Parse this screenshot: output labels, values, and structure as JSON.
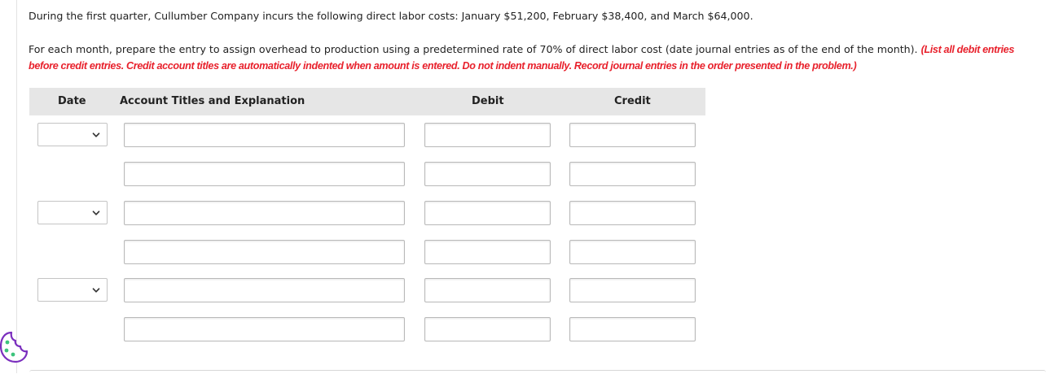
{
  "problem": {
    "intro": "During the first quarter, Cullumber Company incurs the following direct labor costs: January $51,200, February $38,400, and March $64,000.",
    "instruction": "For each month, prepare the entry to assign overhead to production using a predetermined rate of 70% of direct labor cost (date journal entries as of the end of the month).",
    "note": "(List all debit entries before credit entries. Credit account titles are automatically indented when amount is entered. Do not indent manually. Record journal entries in the order presented in the problem.)"
  },
  "table": {
    "headers": {
      "date": "Date",
      "account": "Account Titles and Explanation",
      "debit": "Debit",
      "credit": "Credit"
    },
    "rows": [
      {
        "has_date": true,
        "date": "",
        "account": "",
        "debit": "",
        "credit": ""
      },
      {
        "has_date": false,
        "account": "",
        "debit": "",
        "credit": ""
      },
      {
        "has_date": true,
        "date": "",
        "account": "",
        "debit": "",
        "credit": ""
      },
      {
        "has_date": false,
        "account": "",
        "debit": "",
        "credit": ""
      },
      {
        "has_date": true,
        "date": "",
        "account": "",
        "debit": "",
        "credit": ""
      },
      {
        "has_date": false,
        "account": "",
        "debit": "",
        "credit": ""
      }
    ]
  },
  "icons": {
    "date_select": "chevron-down-icon",
    "helper": "cookie-icon"
  },
  "colors": {
    "note_red": "#e8212c",
    "header_bg": "#e6e6e6",
    "cookie_green": "#3cc47c",
    "cookie_purple": "#7b2fbe"
  }
}
